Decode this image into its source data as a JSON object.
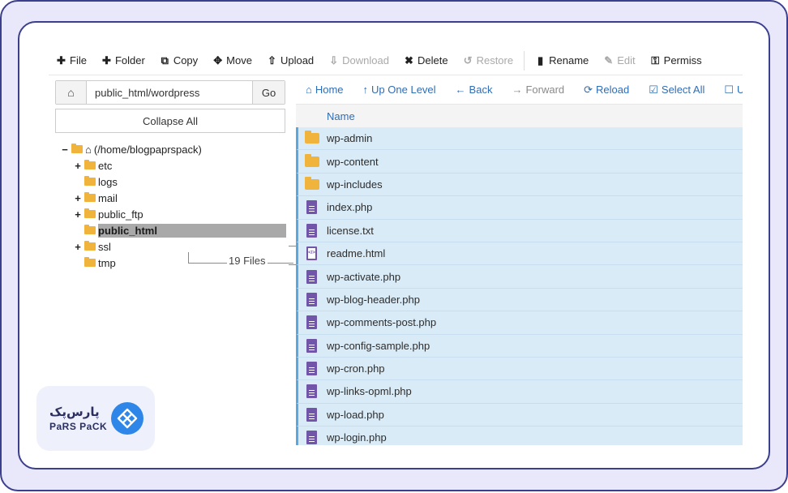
{
  "toolbar": {
    "file": "File",
    "folder": "Folder",
    "copy": "Copy",
    "move": "Move",
    "upload": "Upload",
    "download": "Download",
    "delete": "Delete",
    "restore": "Restore",
    "rename": "Rename",
    "edit": "Edit",
    "permissions": "Permiss"
  },
  "path_bar": {
    "value": "public_html/wordpress",
    "go": "Go"
  },
  "collapse_all": "Collapse All",
  "tree": {
    "root": "(/home/blogpaprspack)",
    "items": [
      {
        "toggle": "+",
        "label": "etc"
      },
      {
        "toggle": "",
        "label": "logs"
      },
      {
        "toggle": "+",
        "label": "mail"
      },
      {
        "toggle": "+",
        "label": "public_ftp"
      },
      {
        "toggle": "",
        "label": "public_html"
      },
      {
        "toggle": "+",
        "label": "ssl"
      },
      {
        "toggle": "",
        "label": "tmp"
      }
    ],
    "selected": "public_html",
    "files_count": "19 Files"
  },
  "nav": {
    "home": "Home",
    "up_one_level": "Up One Level",
    "back": "Back",
    "forward": "Forward",
    "reload": "Reload",
    "select_all": "Select All",
    "unselect": "U"
  },
  "table": {
    "column_name": "Name",
    "rows": [
      {
        "name": "wp-admin",
        "type": "folder",
        "selected": true
      },
      {
        "name": "wp-content",
        "type": "folder",
        "selected": true
      },
      {
        "name": "wp-includes",
        "type": "folder",
        "selected": true
      },
      {
        "name": "index.php",
        "type": "doc",
        "selected": true
      },
      {
        "name": "license.txt",
        "type": "doc",
        "selected": true
      },
      {
        "name": "readme.html",
        "type": "html",
        "selected": true
      },
      {
        "name": "wp-activate.php",
        "type": "doc",
        "selected": true
      },
      {
        "name": "wp-blog-header.php",
        "type": "doc",
        "selected": true
      },
      {
        "name": "wp-comments-post.php",
        "type": "doc",
        "selected": true
      },
      {
        "name": "wp-config-sample.php",
        "type": "doc",
        "selected": true
      },
      {
        "name": "wp-cron.php",
        "type": "doc",
        "selected": true
      },
      {
        "name": "wp-links-opml.php",
        "type": "doc",
        "selected": true
      },
      {
        "name": "wp-load.php",
        "type": "doc",
        "selected": true
      },
      {
        "name": "wp-login.php",
        "type": "doc",
        "selected": true
      }
    ]
  },
  "logo": {
    "fa": "پارس‌پک",
    "en": "PaRS PaCK"
  },
  "colors": {
    "frame_border": "#3b3f8e",
    "frame_bg": "#e9e8fb",
    "link_blue": "#2f6db5",
    "selected_row": "#d9ebf7",
    "folder": "#f0b43c",
    "doc": "#7155a8",
    "tree_selected": "#a9a9a9",
    "logo_blue": "#2d86e8"
  }
}
